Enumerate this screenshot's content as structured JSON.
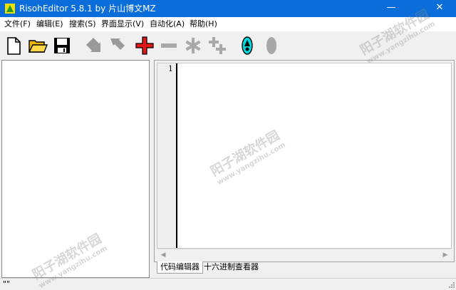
{
  "window": {
    "title": "RisohEditor 5.8.1 by 片山博文MZ",
    "minimize_glyph": "—",
    "close_glyph": "✕"
  },
  "menu": {
    "items": [
      "文件(F)",
      "编辑(E)",
      "搜索(S)",
      "界面显示(V)",
      "自动化(A)",
      "帮助(H)"
    ]
  },
  "toolbar": {
    "buttons": [
      {
        "icon": "new-file-icon"
      },
      {
        "icon": "open-folder-icon"
      },
      {
        "icon": "save-icon"
      },
      {
        "icon": "move-down-icon"
      },
      {
        "icon": "move-up-icon"
      },
      {
        "icon": "add-icon"
      },
      {
        "icon": "remove-icon"
      },
      {
        "icon": "modify-icon"
      },
      {
        "icon": "copy-icon"
      },
      {
        "icon": "test-icon"
      },
      {
        "icon": "cancel-icon"
      }
    ]
  },
  "editor": {
    "line_numbers": [
      "1"
    ],
    "content": ""
  },
  "tabs": [
    {
      "label": "代码编辑器",
      "active": true
    },
    {
      "label": "十六进制查看器",
      "active": false
    }
  ],
  "status": {
    "text": "\"\""
  },
  "watermark": {
    "text": "阳子湖软件园",
    "url": "www.yangzihu.com"
  },
  "colors": {
    "titlebar": "#0a6dd9",
    "add_red": "#e01818",
    "test_cyan": "#00d8e0"
  }
}
